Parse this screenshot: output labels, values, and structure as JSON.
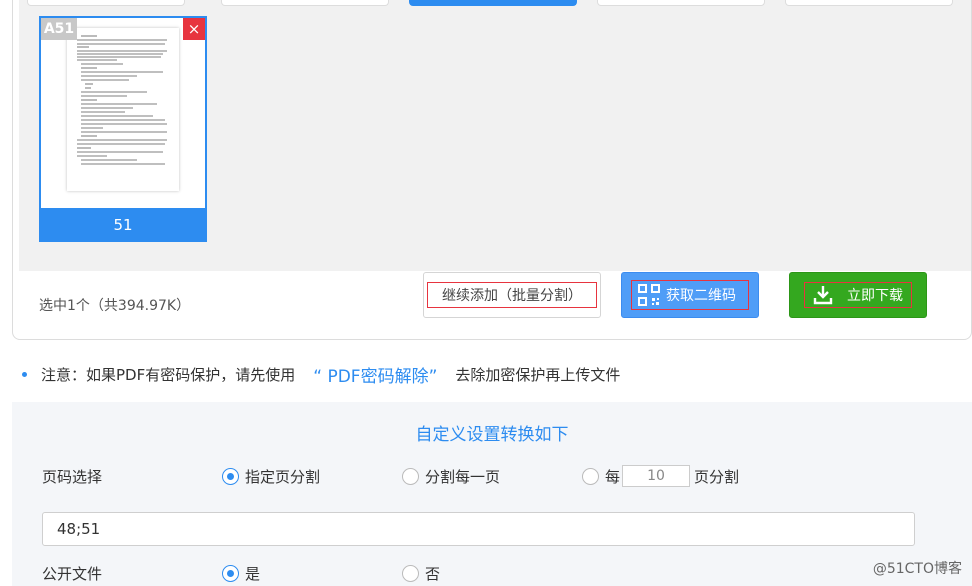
{
  "thumbnail": {
    "badge": "A51",
    "close": "×",
    "page_label": "51"
  },
  "status": {
    "selected_text": "选中1个（共394.97K）"
  },
  "buttons": {
    "continue_label": "继续添加（批量分割）",
    "qr_label": "获取二维码",
    "download_label": "立即下载"
  },
  "note": {
    "prefix": "注意：如果PDF有密码保护，请先使用",
    "link": "“ PDF密码解除”",
    "suffix": "去除加密保护再上传文件"
  },
  "settings": {
    "title": "自定义设置转换如下",
    "page_select_label": "页码选择",
    "option_specified": "指定页分割",
    "option_each": "分割每一页",
    "option_every_prefix": "每",
    "option_every_value": "10",
    "option_every_suffix": "页分割",
    "pages_value": "48;51",
    "public_label": "公开文件",
    "public_yes": "是",
    "public_no": "否"
  },
  "watermark": "@51CTO博客",
  "colors": {
    "accent": "#2d8cf0",
    "download_green": "#34a81f",
    "close_red": "#e7343f"
  }
}
